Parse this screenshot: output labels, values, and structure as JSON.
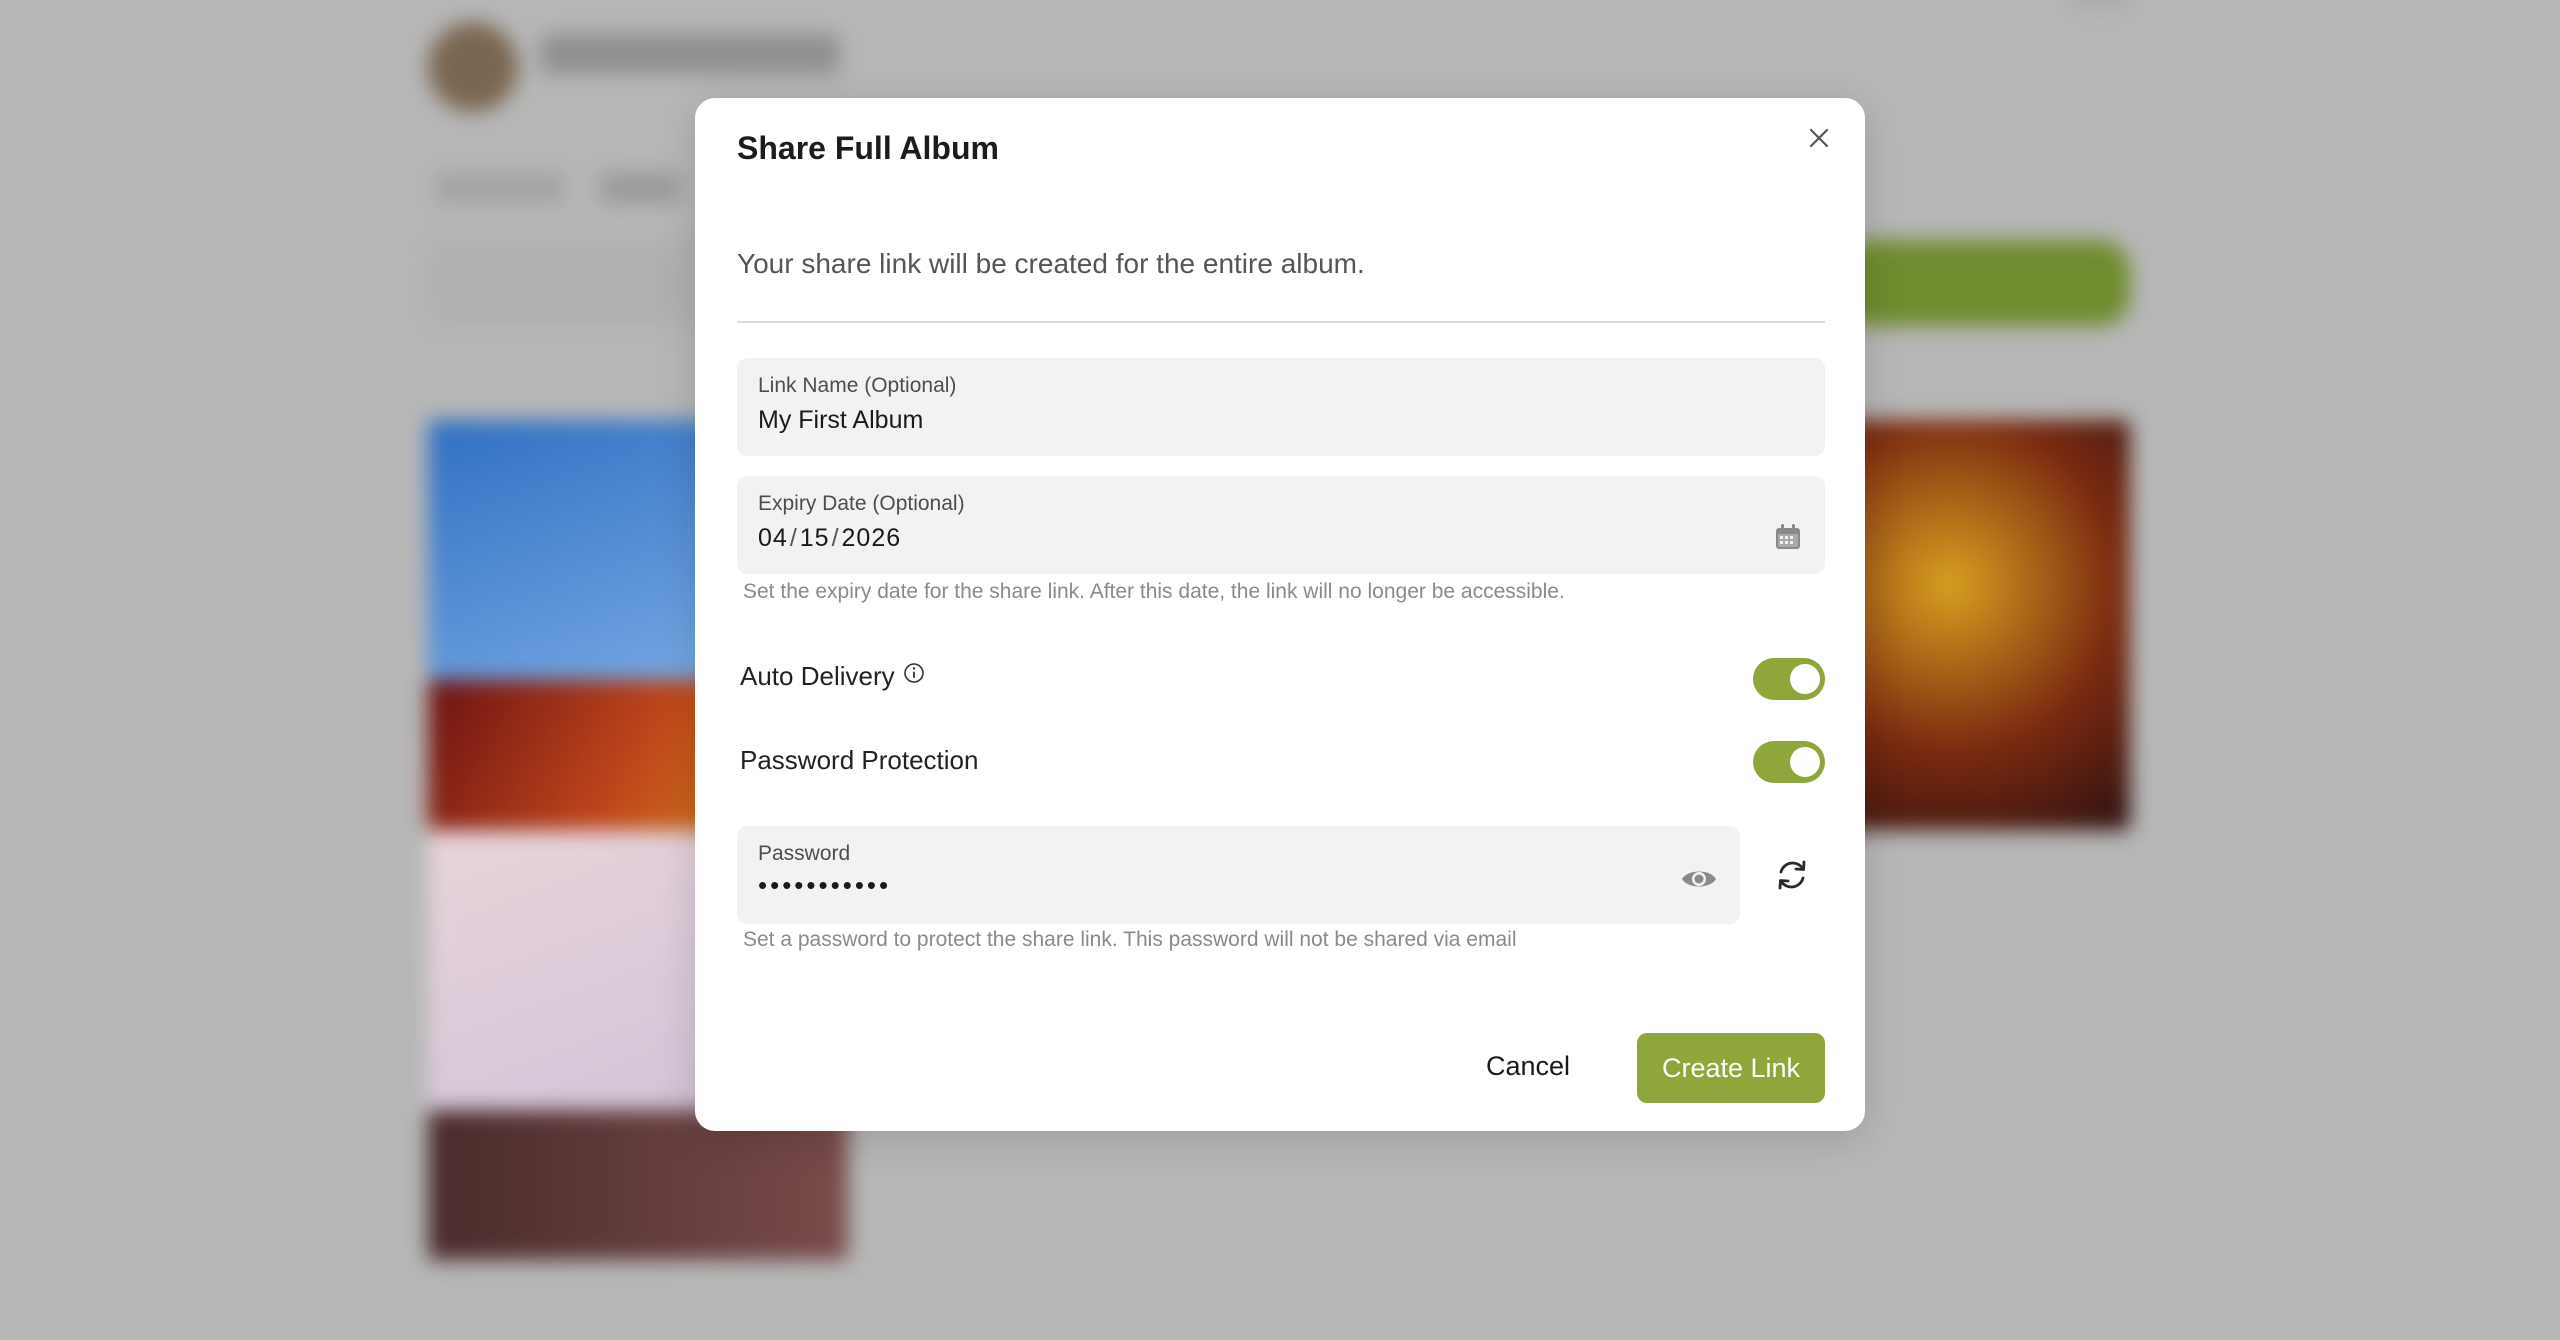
{
  "modal": {
    "title": "Share Full Album",
    "subtitle": "Your share link will be created for the entire album."
  },
  "link_name": {
    "label": "Link Name (Optional)",
    "value": "My First Album"
  },
  "expiry_date": {
    "label": "Expiry Date (Optional)",
    "month": "04",
    "day": "15",
    "year": "2026",
    "separator": "/",
    "hint": "Set the expiry date for the share link. After this date, the link will no longer be accessible."
  },
  "auto_delivery": {
    "label": "Auto Delivery",
    "enabled": true
  },
  "password_protection": {
    "label": "Password Protection",
    "enabled": true
  },
  "password": {
    "label": "Password",
    "masked_value": "•••••••••••",
    "hint": "Set a password to protect the share link. This password will not be shared via email"
  },
  "actions": {
    "cancel_label": "Cancel",
    "create_label": "Create Link"
  },
  "colors": {
    "accent": "#8fa73a",
    "overlay": "#b7b7b7",
    "field_bg": "#f2f2f2"
  },
  "icons": {
    "close": "close-icon",
    "calendar": "calendar-icon",
    "info": "info-icon",
    "eye": "eye-icon",
    "refresh": "refresh-icon"
  }
}
